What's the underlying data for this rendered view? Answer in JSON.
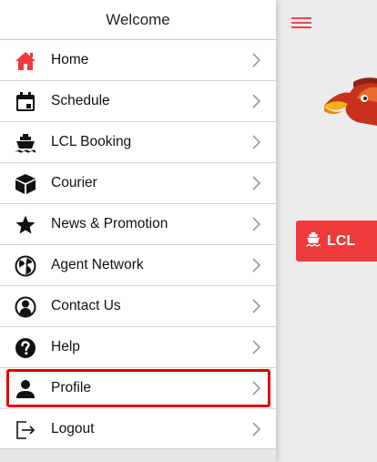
{
  "drawer": {
    "title": "Welcome",
    "items": [
      {
        "label": "Home",
        "icon": "home-icon"
      },
      {
        "label": "Schedule",
        "icon": "calendar-icon"
      },
      {
        "label": "LCL Booking",
        "icon": "ship-icon"
      },
      {
        "label": "Courier",
        "icon": "box-icon"
      },
      {
        "label": "News & Promotion",
        "icon": "star-icon"
      },
      {
        "label": "Agent Network",
        "icon": "globe-icon"
      },
      {
        "label": "Contact Us",
        "icon": "contact-icon"
      },
      {
        "label": "Help",
        "icon": "help-icon"
      },
      {
        "label": "Profile",
        "icon": "person-icon",
        "selected": true
      },
      {
        "label": "Logout",
        "icon": "logout-icon"
      }
    ]
  },
  "app": {
    "lcl_button_label": "LCL",
    "accent_color": "#ef3b3b",
    "highlight_color": "#e00000"
  }
}
